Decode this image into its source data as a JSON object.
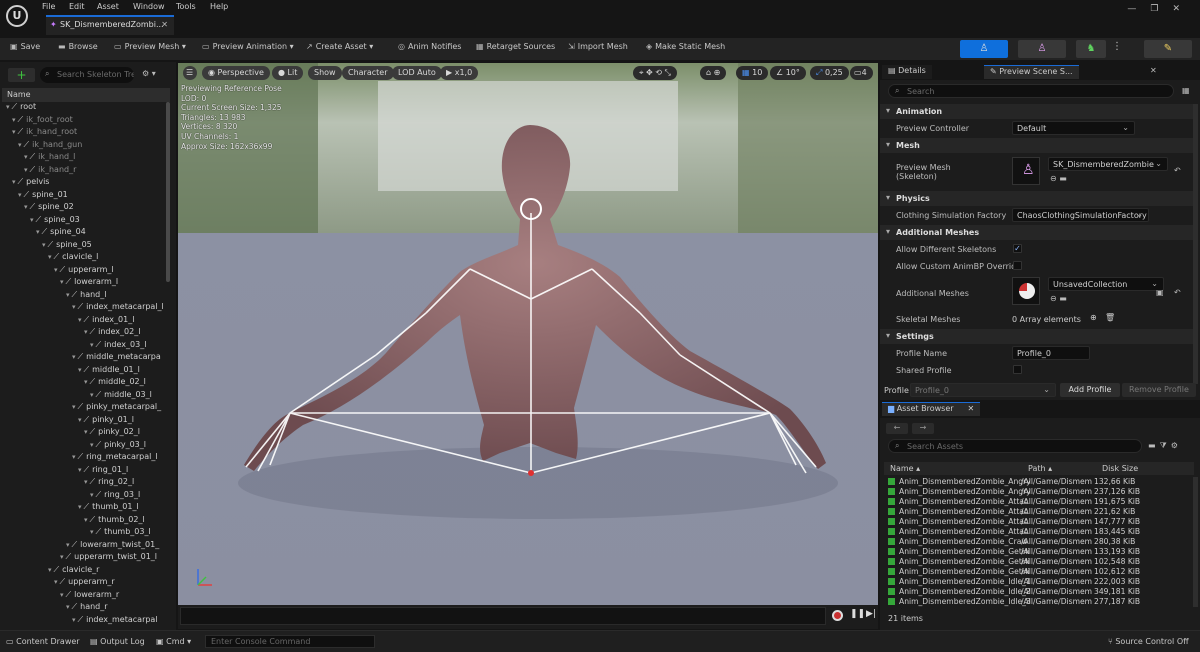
{
  "app": {
    "logo": "U",
    "menu": [
      "File",
      "Edit",
      "Asset",
      "Window",
      "Tools",
      "Help"
    ],
    "tab_title": "SK_DismemberedZombi...",
    "window_controls": [
      "—",
      "❐",
      "✕"
    ]
  },
  "toolbar": {
    "save": "Save",
    "browse": "Browse",
    "preview_mesh": "Preview Mesh",
    "preview_animation": "Preview Animation",
    "create_asset": "Create Asset",
    "anim_notifies": "Anim Notifies",
    "retarget_sources": "Retarget Sources",
    "import_mesh": "Import Mesh",
    "make_static_mesh": "Make Static Mesh"
  },
  "skeleton_tree": {
    "search_placeholder": "Search Skeleton Tre",
    "name_header": "Name",
    "bones": [
      {
        "name": "root",
        "depth": 0,
        "gray": false
      },
      {
        "name": "ik_foot_root",
        "depth": 1,
        "gray": true
      },
      {
        "name": "ik_hand_root",
        "depth": 1,
        "gray": true
      },
      {
        "name": "ik_hand_gun",
        "depth": 2,
        "gray": true
      },
      {
        "name": "ik_hand_l",
        "depth": 3,
        "gray": true
      },
      {
        "name": "ik_hand_r",
        "depth": 3,
        "gray": true
      },
      {
        "name": "pelvis",
        "depth": 1,
        "gray": false
      },
      {
        "name": "spine_01",
        "depth": 2,
        "gray": false
      },
      {
        "name": "spine_02",
        "depth": 3,
        "gray": false
      },
      {
        "name": "spine_03",
        "depth": 4,
        "gray": false
      },
      {
        "name": "spine_04",
        "depth": 5,
        "gray": false
      },
      {
        "name": "spine_05",
        "depth": 6,
        "gray": false
      },
      {
        "name": "clavicle_l",
        "depth": 7,
        "gray": false
      },
      {
        "name": "upperarm_l",
        "depth": 8,
        "gray": false
      },
      {
        "name": "lowerarm_l",
        "depth": 9,
        "gray": false
      },
      {
        "name": "hand_l",
        "depth": 10,
        "gray": false
      },
      {
        "name": "index_metacarpal_l",
        "depth": 11,
        "gray": false
      },
      {
        "name": "index_01_l",
        "depth": 12,
        "gray": false
      },
      {
        "name": "index_02_l",
        "depth": 13,
        "gray": false
      },
      {
        "name": "index_03_l",
        "depth": 14,
        "gray": false
      },
      {
        "name": "middle_metacarpa",
        "depth": 11,
        "gray": false
      },
      {
        "name": "middle_01_l",
        "depth": 12,
        "gray": false
      },
      {
        "name": "middle_02_l",
        "depth": 13,
        "gray": false
      },
      {
        "name": "middle_03_l",
        "depth": 14,
        "gray": false
      },
      {
        "name": "pinky_metacarpal_",
        "depth": 11,
        "gray": false
      },
      {
        "name": "pinky_01_l",
        "depth": 12,
        "gray": false
      },
      {
        "name": "pinky_02_l",
        "depth": 13,
        "gray": false
      },
      {
        "name": "pinky_03_l",
        "depth": 14,
        "gray": false
      },
      {
        "name": "ring_metacarpal_l",
        "depth": 11,
        "gray": false
      },
      {
        "name": "ring_01_l",
        "depth": 12,
        "gray": false
      },
      {
        "name": "ring_02_l",
        "depth": 13,
        "gray": false
      },
      {
        "name": "ring_03_l",
        "depth": 14,
        "gray": false
      },
      {
        "name": "thumb_01_l",
        "depth": 12,
        "gray": false
      },
      {
        "name": "thumb_02_l",
        "depth": 13,
        "gray": false
      },
      {
        "name": "thumb_03_l",
        "depth": 14,
        "gray": false
      },
      {
        "name": "lowerarm_twist_01_",
        "depth": 10,
        "gray": false
      },
      {
        "name": "upperarm_twist_01_l",
        "depth": 9,
        "gray": false
      },
      {
        "name": "clavicle_r",
        "depth": 7,
        "gray": false
      },
      {
        "name": "upperarm_r",
        "depth": 8,
        "gray": false
      },
      {
        "name": "lowerarm_r",
        "depth": 9,
        "gray": false
      },
      {
        "name": "hand_r",
        "depth": 10,
        "gray": false
      },
      {
        "name": "index_metacarpal",
        "depth": 11,
        "gray": false
      }
    ]
  },
  "viewport": {
    "perspective": "Perspective",
    "lit": "Lit",
    "show": "Show",
    "character": "Character",
    "lod": "LOD Auto",
    "speed": "x1,0",
    "grid_size": "10",
    "rot_snap": "10°",
    "scale_snap": "0,25",
    "cam_speed": "4",
    "stats": [
      "Previewing Reference Pose",
      "LOD: 0",
      "Current Screen Size: 1,325",
      "Triangles: 13 983",
      "Vertices: 8 320",
      "UV Channels: 1",
      "Approx Size: 162x36x99"
    ]
  },
  "details": {
    "tab_details": "Details",
    "tab_preview": "Preview Scene S...",
    "search_placeholder": "Search",
    "sections": {
      "animation": "Animation",
      "mesh": "Mesh",
      "physics": "Physics",
      "additional_meshes": "Additional Meshes",
      "settings": "Settings"
    },
    "preview_controller_label": "Preview Controller",
    "preview_controller_value": "Default",
    "preview_mesh_label": "Preview Mesh\n(Skeleton)",
    "preview_mesh_value": "SK_DismemberedZombie",
    "clothing_label": "Clothing Simulation Factory",
    "clothing_value": "ChaosClothingSimulationFactory",
    "allow_diff_label": "Allow Different Skeletons",
    "allow_custom_label": "Allow Custom AnimBP Override",
    "additional_meshes_label": "Additional Meshes",
    "additional_meshes_value": "UnsavedCollection",
    "skeletal_meshes_label": "Skeletal Meshes",
    "skeletal_meshes_value": "0 Array elements",
    "profile_name_label": "Profile Name",
    "profile_name_value": "Profile_0",
    "shared_profile_label": "Shared Profile",
    "profile_label": "Profile",
    "profile_value": "Profile_0",
    "add_profile": "Add Profile",
    "remove_profile": "Remove Profile"
  },
  "asset_browser": {
    "title": "Asset Browser",
    "search_placeholder": "Search Assets",
    "col_name": "Name",
    "col_path": "Path",
    "col_size": "Disk Size",
    "item_count": "21 items",
    "items": [
      {
        "name": "Anim_DismemberedZombie_Angry",
        "path": "/All/Game/Dismem",
        "size": "132,66 KiB"
      },
      {
        "name": "Anim_DismemberedZombie_Angry",
        "path": "/All/Game/Dismem",
        "size": "237,126 KiB"
      },
      {
        "name": "Anim_DismemberedZombie_Attac",
        "path": "/All/Game/Dismem",
        "size": "191,675 KiB"
      },
      {
        "name": "Anim_DismemberedZombie_Attac",
        "path": "/All/Game/Dismem",
        "size": "221,62 KiB"
      },
      {
        "name": "Anim_DismemberedZombie_Attac",
        "path": "/All/Game/Dismem",
        "size": "147,777 KiB"
      },
      {
        "name": "Anim_DismemberedZombie_Attac",
        "path": "/All/Game/Dismem",
        "size": "183,445 KiB"
      },
      {
        "name": "Anim_DismemberedZombie_Craw",
        "path": "/All/Game/Dismem",
        "size": "280,38 KiB"
      },
      {
        "name": "Anim_DismemberedZombie_GetHi",
        "path": "/All/Game/Dismem",
        "size": "133,193 KiB"
      },
      {
        "name": "Anim_DismemberedZombie_GetHi",
        "path": "/All/Game/Dismem",
        "size": "102,548 KiB"
      },
      {
        "name": "Anim_DismemberedZombie_GetHi",
        "path": "/All/Game/Dismem",
        "size": "102,612 KiB"
      },
      {
        "name": "Anim_DismemberedZombie_Idle_1",
        "path": "/All/Game/Dismem",
        "size": "222,003 KiB"
      },
      {
        "name": "Anim_DismemberedZombie_Idle_2",
        "path": "/All/Game/Dismem",
        "size": "349,181 KiB"
      },
      {
        "name": "Anim_DismemberedZombie_Idle_3",
        "path": "/All/Game/Dismem",
        "size": "277,187 KiB"
      }
    ]
  },
  "statusbar": {
    "content_drawer": "Content Drawer",
    "output_log": "Output Log",
    "cmd": "Cmd",
    "console_placeholder": "Enter Console Command",
    "source_control": "Source Control Off"
  }
}
